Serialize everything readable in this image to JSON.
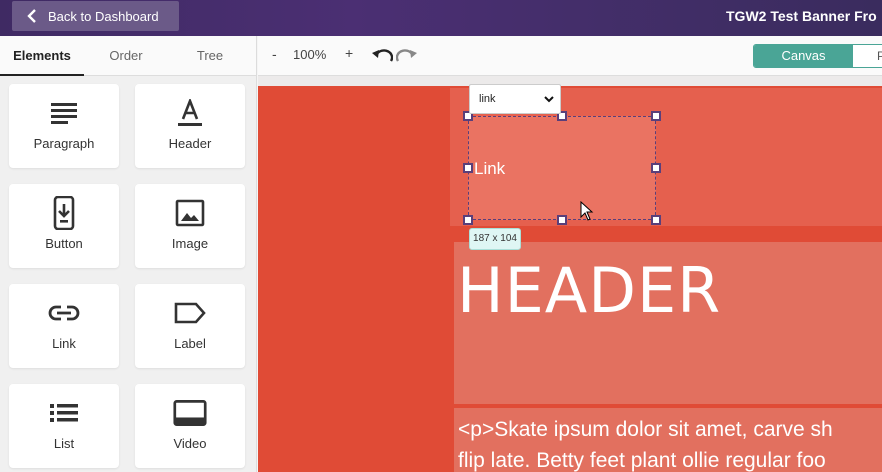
{
  "topbar": {
    "back_label": "Back to Dashboard",
    "title": "TGW2 Test Banner Fro"
  },
  "sidebar": {
    "tabs": [
      {
        "label": "Elements",
        "active": true
      },
      {
        "label": "Order",
        "active": false
      },
      {
        "label": "Tree",
        "active": false
      }
    ],
    "items": [
      {
        "label": "Paragraph",
        "icon": "paragraph-icon"
      },
      {
        "label": "Header",
        "icon": "header-icon"
      },
      {
        "label": "Button",
        "icon": "button-icon"
      },
      {
        "label": "Image",
        "icon": "image-icon"
      },
      {
        "label": "Link",
        "icon": "link-icon"
      },
      {
        "label": "Label",
        "icon": "label-icon"
      },
      {
        "label": "List",
        "icon": "list-icon"
      },
      {
        "label": "Video",
        "icon": "video-icon"
      }
    ]
  },
  "toolbar": {
    "zoom_out": "-",
    "zoom_level": "100%",
    "zoom_in": "+",
    "view_active": "Canvas",
    "view_other": "P"
  },
  "canvas": {
    "element_type_select": "link",
    "selected_text": "Link",
    "selection_dims": "187 x 104",
    "header_text": "HEADER",
    "paragraph_line1": "<p>Skate ipsum dolor sit amet, carve sh",
    "paragraph_line2": "flip late. Betty feet plant ollie regular foo"
  },
  "colors": {
    "topbar": "#3f2a63",
    "accent": "#4aa596",
    "banner_bg": "#e04b36",
    "selection_border": "#5a3f7a"
  }
}
